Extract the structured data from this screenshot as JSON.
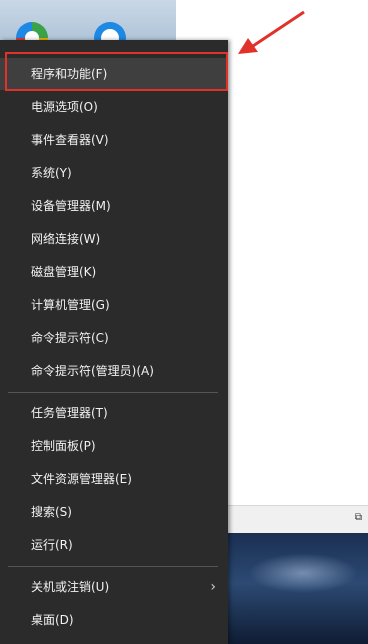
{
  "menu": {
    "items": [
      {
        "label": "程序和功能(F)"
      },
      {
        "label": "电源选项(O)"
      },
      {
        "label": "事件查看器(V)"
      },
      {
        "label": "系统(Y)"
      },
      {
        "label": "设备管理器(M)"
      },
      {
        "label": "网络连接(W)"
      },
      {
        "label": "磁盘管理(K)"
      },
      {
        "label": "计算机管理(G)"
      },
      {
        "label": "命令提示符(C)"
      },
      {
        "label": "命令提示符(管理员)(A)"
      },
      {
        "label": "任务管理器(T)"
      },
      {
        "label": "控制面板(P)"
      },
      {
        "label": "文件资源管理器(E)"
      },
      {
        "label": "搜索(S)"
      },
      {
        "label": "运行(R)"
      },
      {
        "label": "关机或注销(U)"
      },
      {
        "label": "桌面(D)"
      }
    ],
    "highlighted_index": 0
  },
  "colors": {
    "menu_background": "#2b2b2b",
    "highlight_border": "#e0322b",
    "arrow": "#e0322b"
  },
  "icons": {
    "submenu": "chevron-right-icon",
    "annotation": "red-arrow-icon"
  }
}
